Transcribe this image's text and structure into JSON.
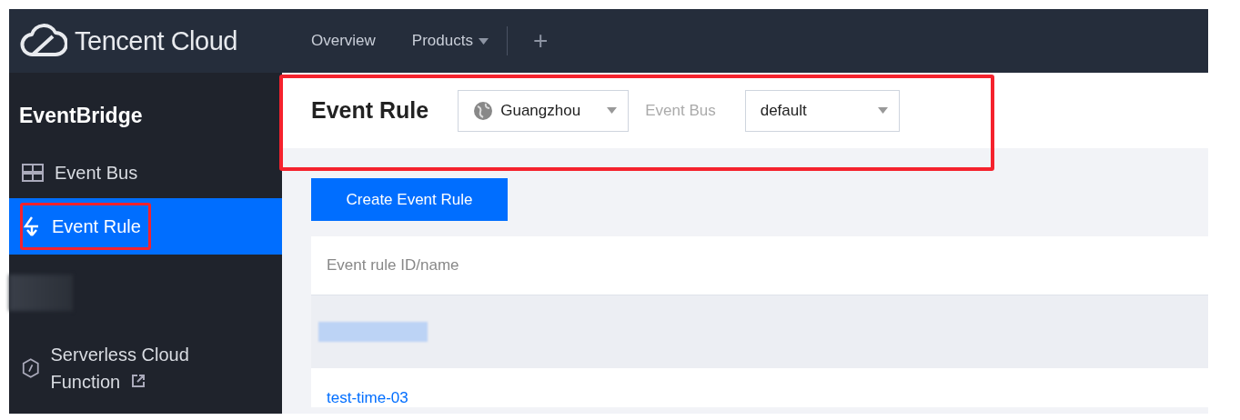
{
  "topbar": {
    "logo": "Tencent Cloud",
    "menu": [
      {
        "label": "Overview",
        "dropdown": false
      },
      {
        "label": "Products",
        "dropdown": true
      }
    ],
    "add": "+"
  },
  "sidebar": {
    "title": "EventBridge",
    "items": [
      {
        "kind": "bus",
        "label": "Event Bus",
        "selected": false,
        "highlighted": false,
        "external": false
      },
      {
        "kind": "rule",
        "label": "Event Rule",
        "selected": true,
        "highlighted": true,
        "external": false
      },
      {
        "kind": "redacted"
      },
      {
        "kind": "function",
        "label": "Serverless Cloud Function",
        "selected": false,
        "highlighted": false,
        "external": true
      }
    ]
  },
  "header": {
    "title": "Event Rule",
    "highlighted": true,
    "region": "Guangzhou",
    "bus_label": "Event Bus",
    "bus": "default"
  },
  "create_button": "Create Event Rule",
  "table": {
    "columns": [
      "Event rule ID/name"
    ],
    "rows": [
      {
        "kind": "redacted"
      },
      {
        "kind": "link",
        "name": "test-time-03"
      }
    ]
  }
}
